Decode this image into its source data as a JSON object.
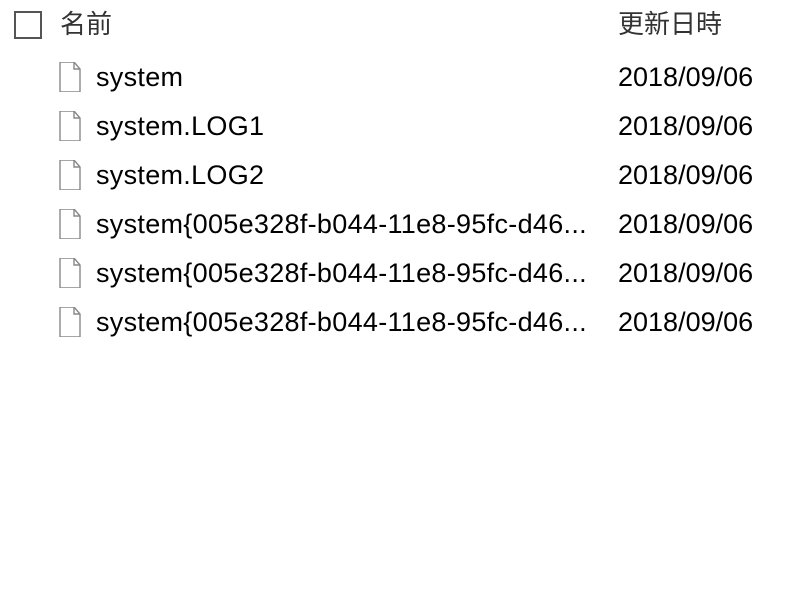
{
  "columns": {
    "name": "名前",
    "date": "更新日時"
  },
  "files": [
    {
      "name": "system",
      "date": "2018/09/06"
    },
    {
      "name": "system.LOG1",
      "date": "2018/09/06"
    },
    {
      "name": "system.LOG2",
      "date": "2018/09/06"
    },
    {
      "name": "system{005e328f-b044-11e8-95fc-d46...",
      "date": "2018/09/06"
    },
    {
      "name": "system{005e328f-b044-11e8-95fc-d46...",
      "date": "2018/09/06"
    },
    {
      "name": "system{005e328f-b044-11e8-95fc-d46...",
      "date": "2018/09/06"
    }
  ]
}
